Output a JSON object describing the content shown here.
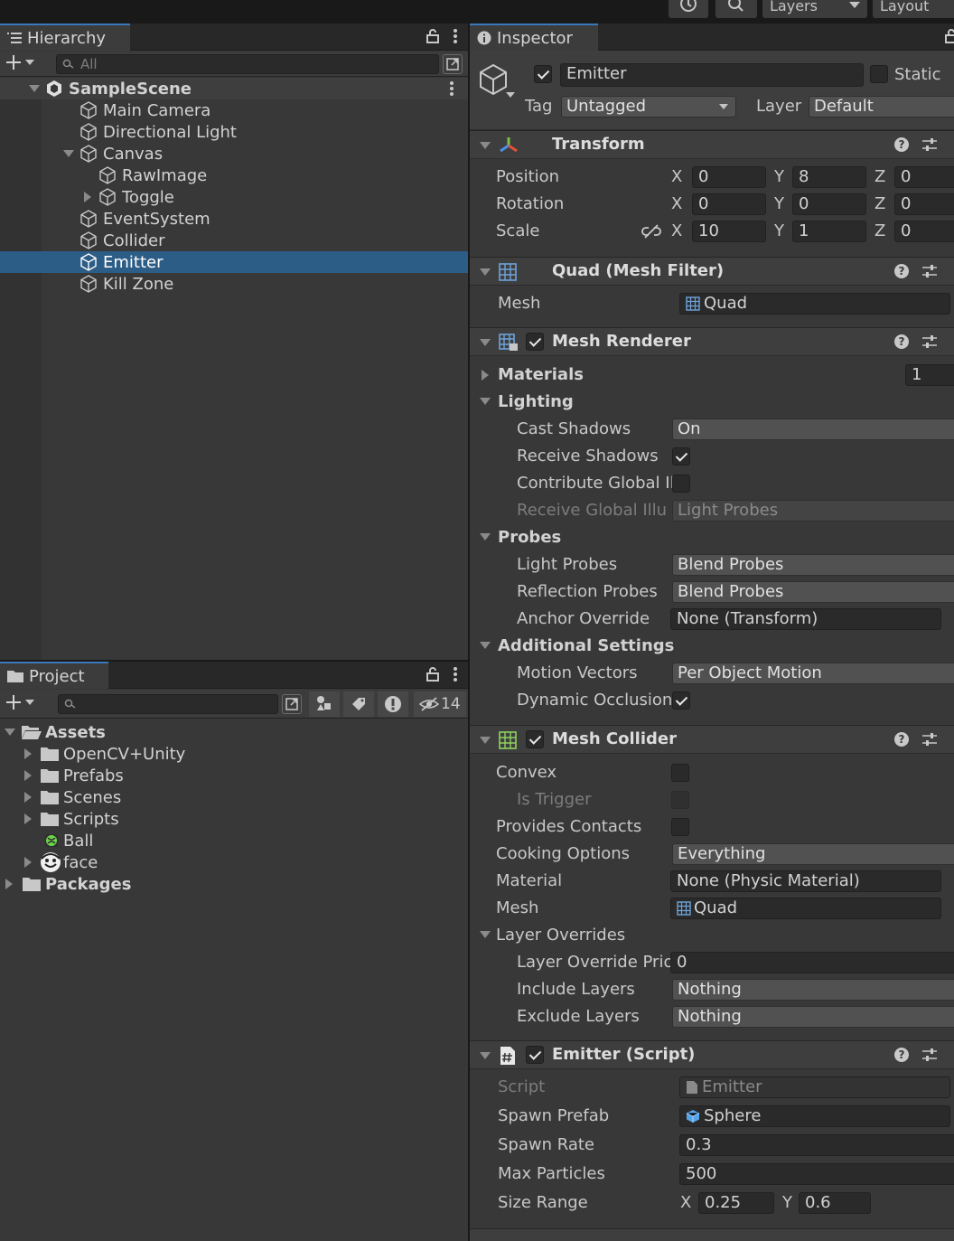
{
  "toolbar": {
    "layers_label": "Layers",
    "layout_label": "Layout"
  },
  "hierarchy": {
    "tab_label": "Hierarchy",
    "search_placeholder": "All",
    "scene_name": "SampleScene",
    "items": [
      {
        "label": "Main Camera",
        "depth": 1
      },
      {
        "label": "Directional Light",
        "depth": 1
      },
      {
        "label": "Canvas",
        "depth": 1,
        "expanded": true
      },
      {
        "label": "RawImage",
        "depth": 2
      },
      {
        "label": "Toggle",
        "depth": 2,
        "collapsed": true
      },
      {
        "label": "EventSystem",
        "depth": 1
      },
      {
        "label": "Collider",
        "depth": 1
      },
      {
        "label": "Emitter",
        "depth": 1,
        "selected": true
      },
      {
        "label": "Kill Zone",
        "depth": 1
      }
    ]
  },
  "project": {
    "tab_label": "Project",
    "hidden_count": "14",
    "tree": [
      {
        "label": "Assets",
        "type": "folder-open"
      },
      {
        "label": "OpenCV+Unity",
        "type": "folder"
      },
      {
        "label": "Prefabs",
        "type": "folder"
      },
      {
        "label": "Scenes",
        "type": "folder"
      },
      {
        "label": "Scripts",
        "type": "folder"
      },
      {
        "label": "Ball",
        "type": "prefab"
      },
      {
        "label": "face",
        "type": "image"
      },
      {
        "label": "Packages",
        "type": "folder"
      }
    ]
  },
  "inspector": {
    "tab_label": "Inspector",
    "object_name": "Emitter",
    "static_label": "Static",
    "tag_label": "Tag",
    "tag_value": "Untagged",
    "layer_label": "Layer",
    "layer_value": "Default",
    "transform": {
      "title": "Transform",
      "position_label": "Position",
      "rotation_label": "Rotation",
      "scale_label": "Scale",
      "position": {
        "x": "0",
        "y": "8",
        "z": "0"
      },
      "rotation": {
        "x": "0",
        "y": "0",
        "z": "0"
      },
      "scale": {
        "x": "10",
        "y": "1",
        "z": "0"
      }
    },
    "mesh_filter": {
      "title": "Quad (Mesh Filter)",
      "mesh_label": "Mesh",
      "mesh_value": "Quad"
    },
    "mesh_renderer": {
      "title": "Mesh Renderer",
      "materials_label": "Materials",
      "materials_count": "1",
      "lighting_label": "Lighting",
      "cast_shadows_label": "Cast Shadows",
      "cast_shadows_value": "On",
      "receive_shadows_label": "Receive Shadows",
      "contribute_gi_label": "Contribute Global Il",
      "receive_gi_label": "Receive Global Illu",
      "receive_gi_value": "Light Probes",
      "probes_label": "Probes",
      "light_probes_label": "Light Probes",
      "light_probes_value": "Blend Probes",
      "reflection_probes_label": "Reflection Probes",
      "reflection_probes_value": "Blend Probes",
      "anchor_override_label": "Anchor Override",
      "anchor_override_value": "None (Transform)",
      "additional_settings_label": "Additional Settings",
      "motion_vectors_label": "Motion Vectors",
      "motion_vectors_value": "Per Object Motion",
      "dynamic_occlusion_label": "Dynamic Occlusion"
    },
    "mesh_collider": {
      "title": "Mesh Collider",
      "convex_label": "Convex",
      "is_trigger_label": "Is Trigger",
      "provides_contacts_label": "Provides Contacts",
      "cooking_options_label": "Cooking Options",
      "cooking_options_value": "Everything",
      "material_label": "Material",
      "material_value": "None (Physic Material)",
      "mesh_label": "Mesh",
      "mesh_value": "Quad",
      "layer_overrides_label": "Layer Overrides",
      "layer_override_prio_label": "Layer Override Prio",
      "layer_override_prio_value": "0",
      "include_layers_label": "Include Layers",
      "include_layers_value": "Nothing",
      "exclude_layers_label": "Exclude Layers",
      "exclude_layers_value": "Nothing"
    },
    "emitter_script": {
      "title": "Emitter (Script)",
      "script_label": "Script",
      "script_value": "Emitter",
      "spawn_prefab_label": "Spawn Prefab",
      "spawn_prefab_value": "Sphere",
      "spawn_rate_label": "Spawn Rate",
      "spawn_rate_value": "0.3",
      "max_particles_label": "Max Particles",
      "max_particles_value": "500",
      "size_range_label": "Size Range",
      "size_range_x": "0.25",
      "size_range_y": "0.6"
    }
  },
  "colors": {
    "selection": "#2c5d87",
    "panel_bg": "#383838",
    "header_bg": "#3e3e3e",
    "field_bg": "#2a2a2a"
  }
}
